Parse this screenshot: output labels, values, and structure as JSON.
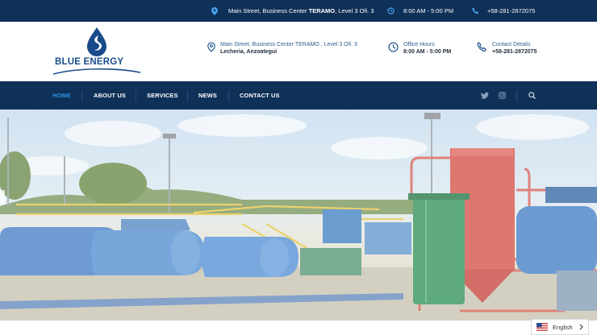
{
  "topbar": {
    "address_prefix": "Main Street, Business Center ",
    "address_bold": "TERAMO",
    "address_suffix": ", Level 3 Ofi. 3",
    "hours": "8:00 AM - 5:00 PM",
    "phone": "+58-281-2872075"
  },
  "header": {
    "brand": "BLUE ENERGY",
    "address": {
      "line1": "Main Street, Business Center TERAMO , Level 3 Ofi. 3",
      "line2": "Lecheria, Anzoategui"
    },
    "hours": {
      "title": "Office Hours",
      "value": "8:00 AM - 5:00 PM"
    },
    "contact": {
      "title": "Contact Details",
      "value": "+58-281-2872075"
    }
  },
  "nav": {
    "items": [
      {
        "label": "HOME",
        "active": true
      },
      {
        "label": "ABOUT US",
        "active": false
      },
      {
        "label": "SERVICES",
        "active": false
      },
      {
        "label": "NEWS",
        "active": false
      },
      {
        "label": "CONTACT US",
        "active": false
      }
    ],
    "icons": [
      "twitter-icon",
      "instagram-icon",
      "search-icon"
    ]
  },
  "language": {
    "selected": "English"
  },
  "colors": {
    "navy": "#0f3057",
    "accent": "#2e8fe0",
    "brand_blue": "#1a4c8b"
  }
}
